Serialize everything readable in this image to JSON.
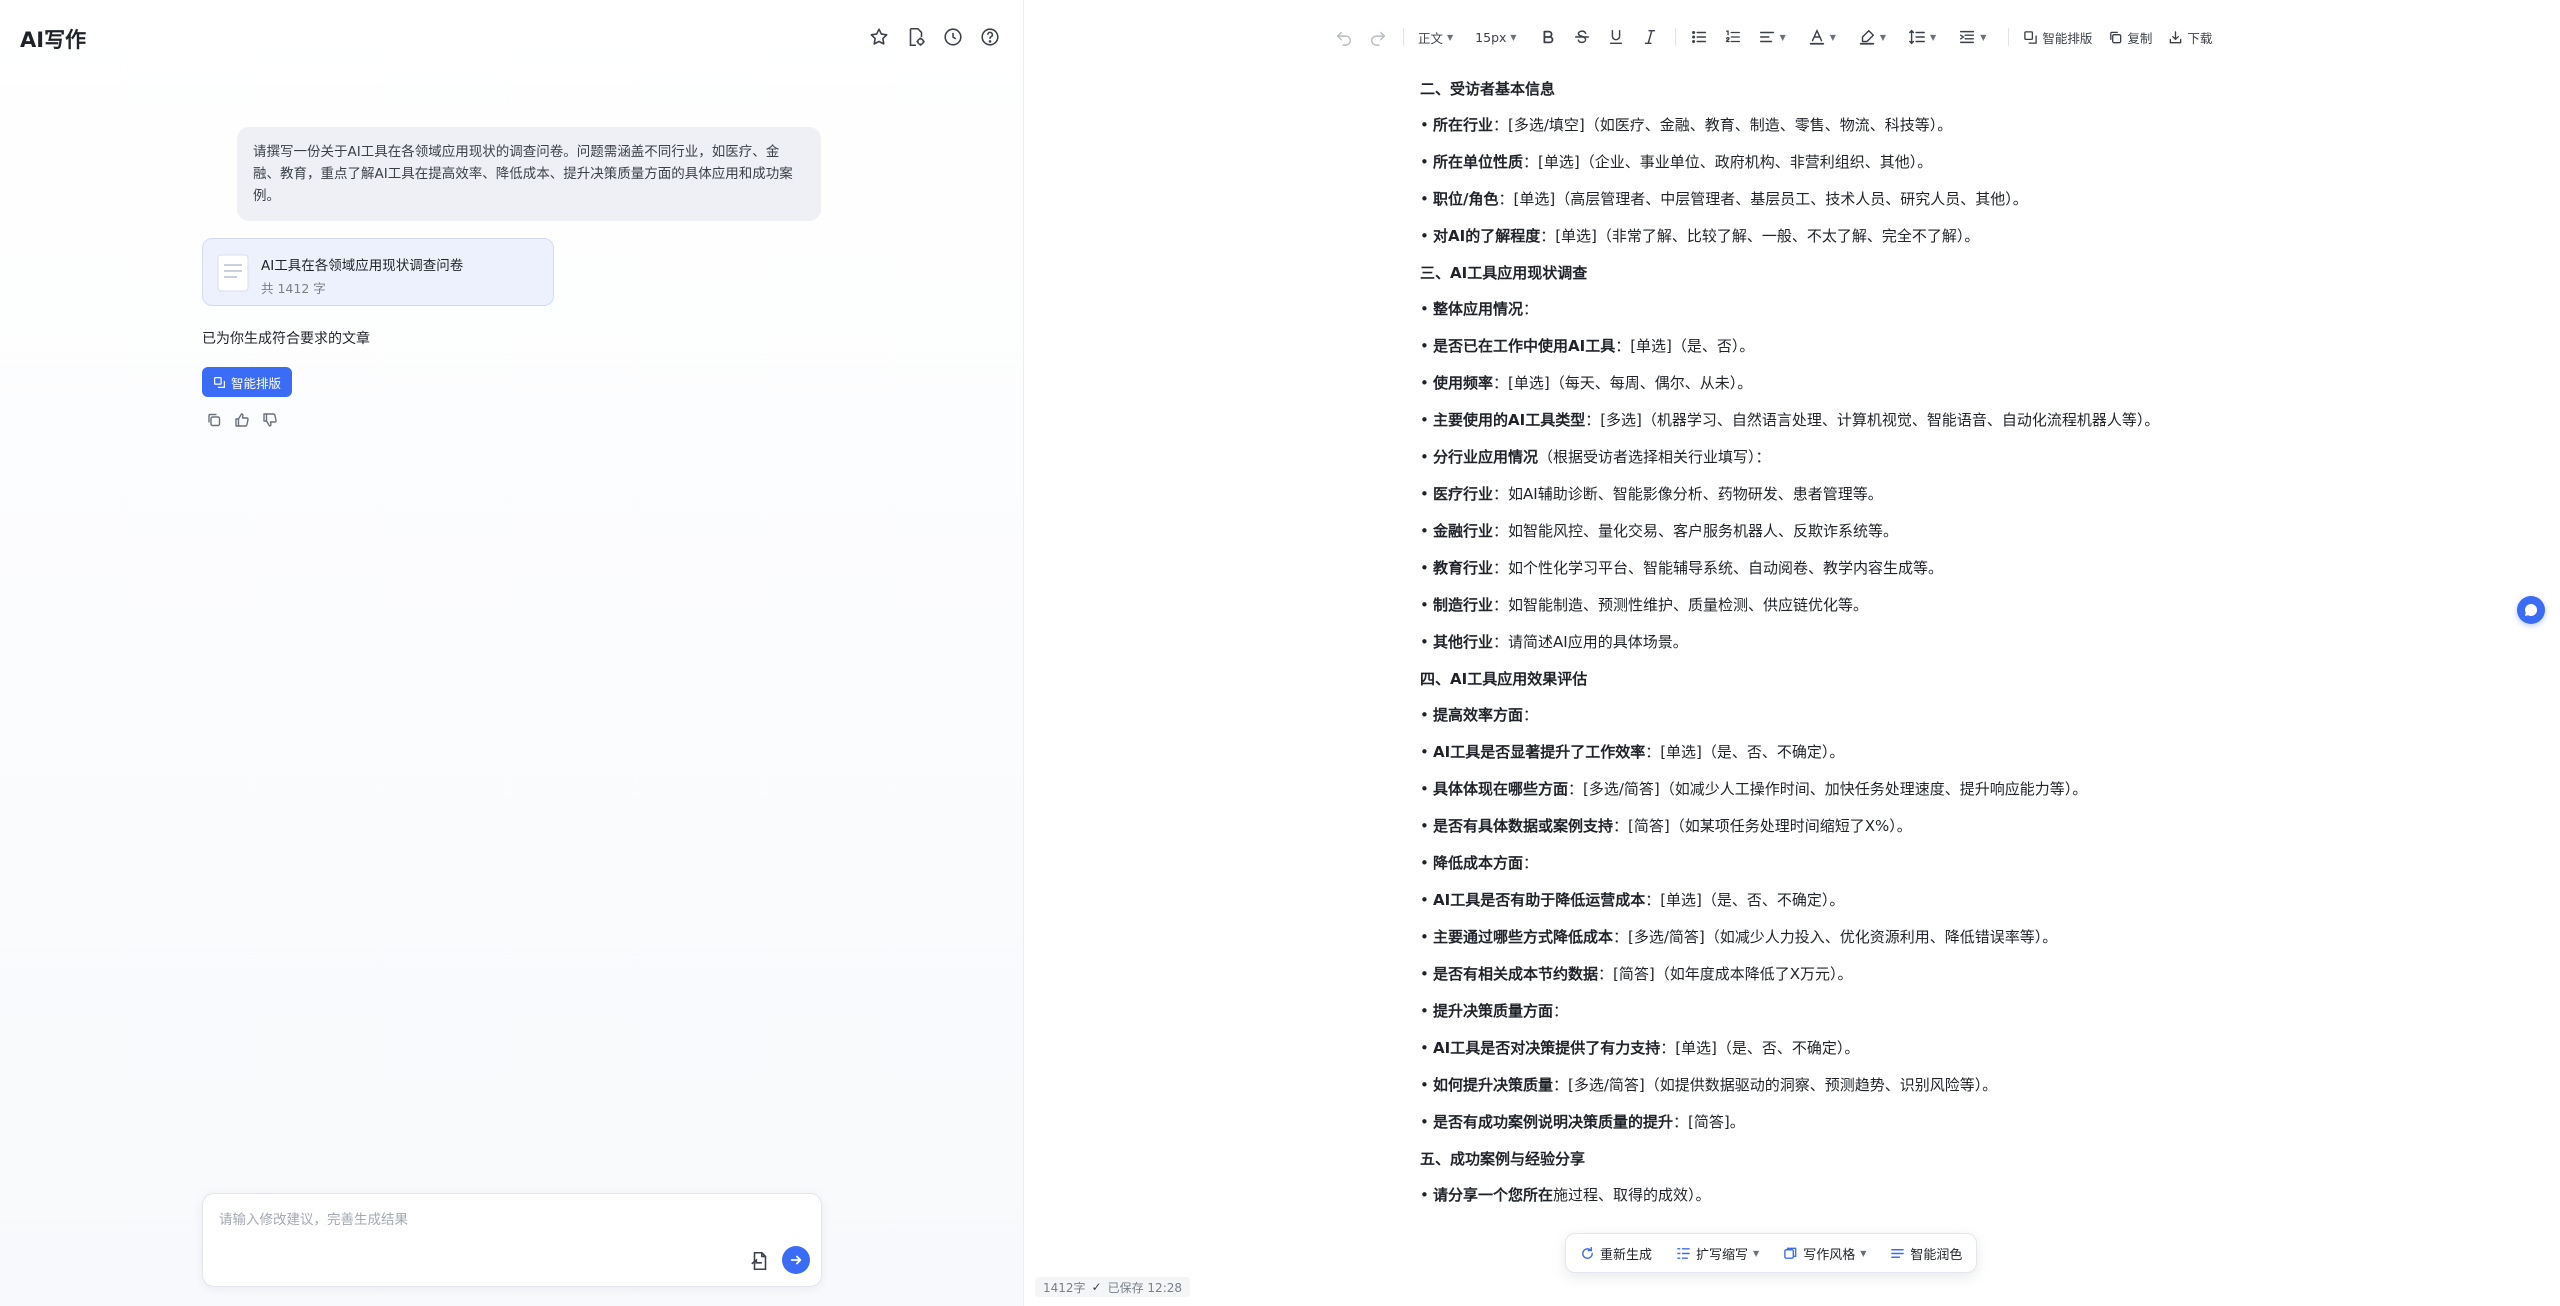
{
  "app": {
    "title": "AI写作"
  },
  "chat": {
    "user_message": "请撰写一份关于AI工具在各领域应用现状的调查问卷。问题需涵盖不同行业，如医疗、金融、教育，重点了解AI工具在提高效率、降低成本、提升决策质量方面的具体应用和成功案例。",
    "doc_card": {
      "title": "AI工具在各领域应用现状调查问卷",
      "word_count": "共 1412 字"
    },
    "generated_text": "已为你生成符合要求的文章",
    "smart_layout_label": "智能排版",
    "input_placeholder": "请输入修改建议，完善生成结果"
  },
  "toolbar": {
    "style_select": "正文",
    "size_select": "15px",
    "smart_layout": "智能排版",
    "copy": "复制",
    "download": "下载"
  },
  "document": {
    "blocks": [
      {
        "type": "h",
        "text": "二、受访者基本信息"
      },
      {
        "type": "li",
        "bold": "所在行业",
        "text": "：[多选/填空]（如医疗、金融、教育、制造、零售、物流、科技等）。"
      },
      {
        "type": "li",
        "bold": "所在单位性质",
        "text": "：[单选]（企业、事业单位、政府机构、非营利组织、其他）。"
      },
      {
        "type": "li",
        "bold": "职位/角色",
        "text": "：[单选]（高层管理者、中层管理者、基层员工、技术人员、研究人员、其他）。"
      },
      {
        "type": "li",
        "bold": "对AI的了解程度",
        "text": "：[单选]（非常了解、比较了解、一般、不太了解、完全不了解）。"
      },
      {
        "type": "h",
        "text": "三、AI工具应用现状调查"
      },
      {
        "type": "li",
        "bold": "整体应用情况",
        "text": "："
      },
      {
        "type": "li",
        "bold": "是否已在工作中使用AI工具",
        "text": "：[单选]（是、否）。"
      },
      {
        "type": "li",
        "bold": "使用频率",
        "text": "：[单选]（每天、每周、偶尔、从未）。"
      },
      {
        "type": "li",
        "bold": "主要使用的AI工具类型",
        "text": "：[多选]（机器学习、自然语言处理、计算机视觉、智能语音、自动化流程机器人等）。"
      },
      {
        "type": "li",
        "bold": "分行业应用情况",
        "text": "（根据受访者选择相关行业填写）："
      },
      {
        "type": "li",
        "bold": "医疗行业",
        "text": "：如AI辅助诊断、智能影像分析、药物研发、患者管理等。"
      },
      {
        "type": "li",
        "bold": "金融行业",
        "text": "：如智能风控、量化交易、客户服务机器人、反欺诈系统等。"
      },
      {
        "type": "li",
        "bold": "教育行业",
        "text": "：如个性化学习平台、智能辅导系统、自动阅卷、教学内容生成等。"
      },
      {
        "type": "li",
        "bold": "制造行业",
        "text": "：如智能制造、预测性维护、质量检测、供应链优化等。"
      },
      {
        "type": "li",
        "bold": "其他行业",
        "text": "：请简述AI应用的具体场景。"
      },
      {
        "type": "h",
        "text": "四、AI工具应用效果评估"
      },
      {
        "type": "li",
        "bold": "提高效率方面",
        "text": "："
      },
      {
        "type": "li",
        "bold": "AI工具是否显著提升了工作效率",
        "text": "：[单选]（是、否、不确定）。"
      },
      {
        "type": "li",
        "bold": "具体体现在哪些方面",
        "text": "：[多选/简答]（如减少人工操作时间、加快任务处理速度、提升响应能力等）。"
      },
      {
        "type": "li",
        "bold": "是否有具体数据或案例支持",
        "text": "：[简答]（如某项任务处理时间缩短了X%）。"
      },
      {
        "type": "li",
        "bold": "降低成本方面",
        "text": "："
      },
      {
        "type": "li",
        "bold": "AI工具是否有助于降低运营成本",
        "text": "：[单选]（是、否、不确定）。"
      },
      {
        "type": "li",
        "bold": "主要通过哪些方式降低成本",
        "text": "：[多选/简答]（如减少人力投入、优化资源利用、降低错误率等）。"
      },
      {
        "type": "li",
        "bold": "是否有相关成本节约数据",
        "text": "：[简答]（如年度成本降低了X万元）。"
      },
      {
        "type": "li",
        "bold": "提升决策质量方面",
        "text": "："
      },
      {
        "type": "li",
        "bold": "AI工具是否对决策提供了有力支持",
        "text": "：[单选]（是、否、不确定）。"
      },
      {
        "type": "li",
        "bold": "如何提升决策质量",
        "text": "：[多选/简答]（如提供数据驱动的洞察、预测趋势、识别风险等）。"
      },
      {
        "type": "li",
        "bold": "是否有成功案例说明决策质量的提升",
        "text": "：[简答]。"
      },
      {
        "type": "h",
        "text": "五、成功案例与经验分享"
      },
      {
        "type": "li",
        "bold": "请分享一个您所在",
        "text": "施过程、取得的成效）。"
      }
    ]
  },
  "status": {
    "word_count": "1412字",
    "saved": "已保存 12:28"
  },
  "floating_bar": {
    "regenerate": "重新生成",
    "expand": "扩写缩写",
    "style": "写作风格",
    "polish": "智能润色"
  }
}
